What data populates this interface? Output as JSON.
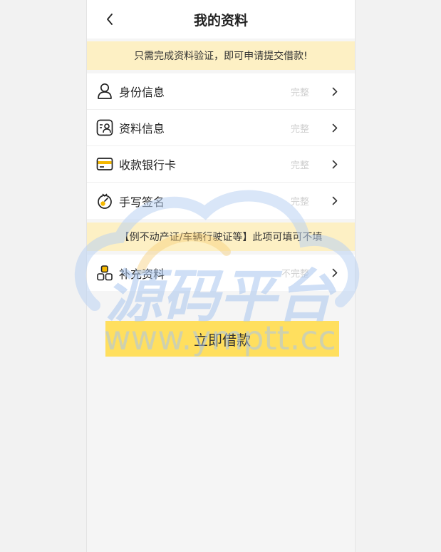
{
  "header": {
    "title": "我的资料"
  },
  "notices": {
    "top": "只需完成资料验证，即可申请提交借款!",
    "optional": "【例不动产证/车辆行驶证等】此项可填可不填"
  },
  "required_items": [
    {
      "label": "身份信息",
      "status": "完整"
    },
    {
      "label": "资料信息",
      "status": "完整"
    },
    {
      "label": "收款银行卡",
      "status": "完整"
    },
    {
      "label": "手写签名",
      "status": "完整"
    }
  ],
  "optional_items": [
    {
      "label": "补充资料",
      "status": "不完整"
    }
  ],
  "submit": {
    "label": "立即借款"
  },
  "watermark": {
    "title": "源码平台",
    "url": "www.ymptt.cc"
  },
  "colors": {
    "accent": "#ffdf5e",
    "notice_bg": "#fdf0c4",
    "icon_yellow": "#f5b800"
  }
}
